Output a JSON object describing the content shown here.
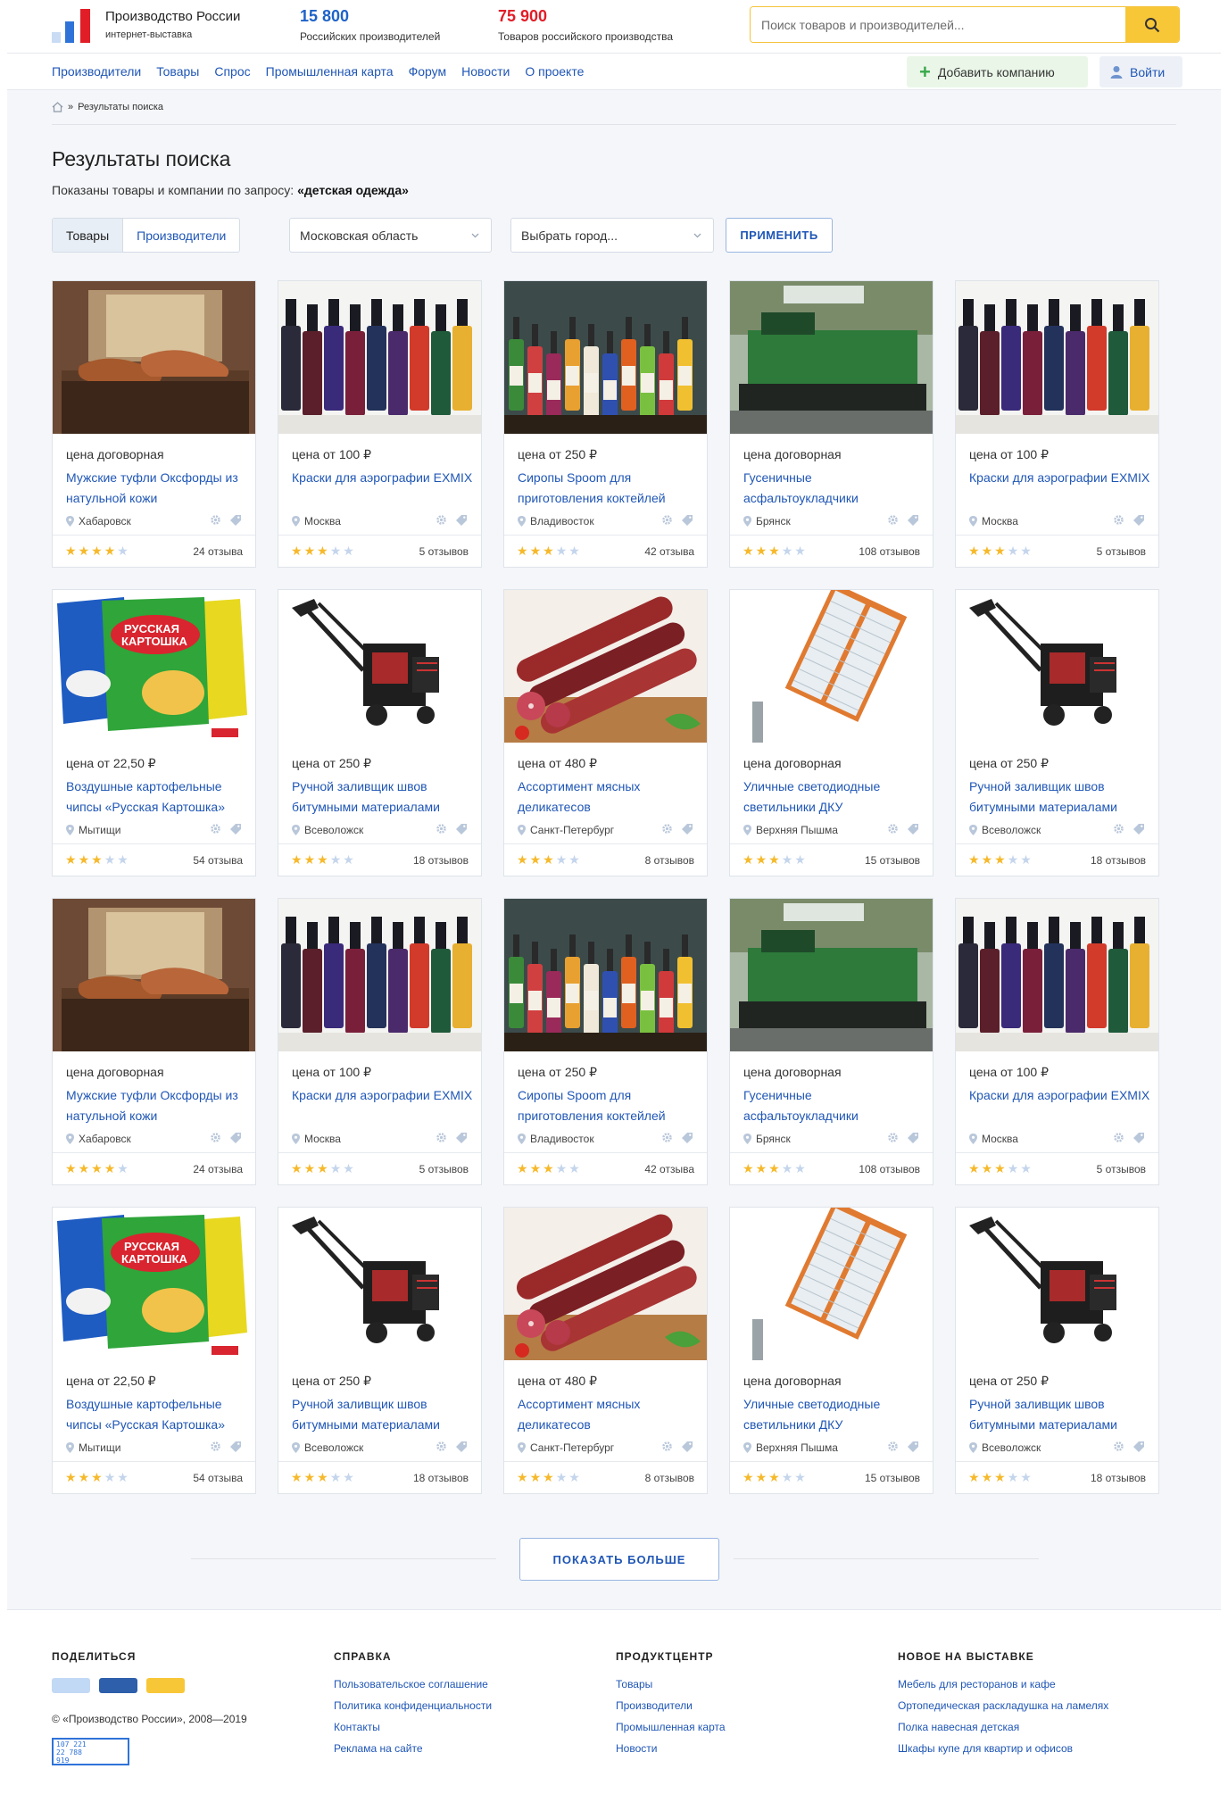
{
  "header": {
    "brand_title": "Производство России",
    "brand_sub": "интернет-выставка",
    "stat1_num": "15 800",
    "stat1_label": "Российских производителей",
    "stat2_num": "75 900",
    "stat2_label": "Товаров российского производства",
    "search_placeholder": "Поиск товаров и производителей..."
  },
  "nav": {
    "links": [
      "Производители",
      "Товары",
      "Спрос",
      "Промышленная карта",
      "Форум",
      "Новости",
      "О проекте"
    ],
    "add_company": "Добавить компанию",
    "login": "Войти"
  },
  "breadcrumb": {
    "sep": "»",
    "current": "Результаты поиска"
  },
  "page": {
    "title": "Результаты поиска",
    "query_prefix": "Показаны товары и компании по запросу:",
    "query": "«детская одежда»"
  },
  "filters": {
    "tab_goods": "Товары",
    "tab_makers": "Производители",
    "region": "Московская область",
    "city_placeholder": "Выбрать город...",
    "apply": "ПРИМЕНИТЬ"
  },
  "products": [
    {
      "price": "цена договорная",
      "title": "Мужские туфли Оксфорды из натульной кожи",
      "city": "Хабаровск",
      "stars": 4,
      "reviews": "24 отзыва",
      "img": "shoes"
    },
    {
      "price": "цена от 100 ₽",
      "title": "Краски для аэрографии EXMIX",
      "city": "Москва",
      "stars": 3,
      "reviews": "5 отзывов",
      "img": "paints"
    },
    {
      "price": "цена от 250 ₽",
      "title": "Сиропы Spoom для приготовления коктейлей",
      "city": "Владивосток",
      "stars": 3,
      "reviews": "42 отзыва",
      "img": "syrups"
    },
    {
      "price": "цена договорная",
      "title": "Гусеничные асфальтоукладчики",
      "city": "Брянск",
      "stars": 3,
      "reviews": "108 отзывов",
      "img": "paver"
    },
    {
      "price": "цена от 100 ₽",
      "title": "Краски для аэрографии EXMIX",
      "city": "Москва",
      "stars": 3,
      "reviews": "5 отзывов",
      "img": "paints"
    },
    {
      "price": "цена от 22,50 ₽",
      "title": "Воздушные картофельные чипсы «Русская Картошка»",
      "city": "Мытищи",
      "stars": 3,
      "reviews": "54 отзыва",
      "img": "chips"
    },
    {
      "price": "цена от 250 ₽",
      "title": "Ручной заливщик швов битумными материалами",
      "city": "Всеволожск",
      "stars": 3,
      "reviews": "18 отзывов",
      "img": "sealer"
    },
    {
      "price": "цена от 480 ₽",
      "title": "Ассортимент мясных деликатесов",
      "city": "Санкт-Петербург",
      "stars": 3,
      "reviews": "8 отзывов",
      "img": "sausage"
    },
    {
      "price": "цена договорная",
      "title": "Уличные светодиодные светильники ДКУ",
      "city": "Верхняя Пышма",
      "stars": 3,
      "reviews": "15 отзывов",
      "img": "lamp"
    },
    {
      "price": "цена от 250 ₽",
      "title": "Ручной заливщик швов битумными материалами",
      "city": "Всеволожск",
      "stars": 3,
      "reviews": "18 отзывов",
      "img": "sealer"
    },
    {
      "price": "цена договорная",
      "title": "Мужские туфли Оксфорды из натульной кожи",
      "city": "Хабаровск",
      "stars": 4,
      "reviews": "24 отзыва",
      "img": "shoes"
    },
    {
      "price": "цена от 100 ₽",
      "title": "Краски для аэрографии EXMIX",
      "city": "Москва",
      "stars": 3,
      "reviews": "5 отзывов",
      "img": "paints"
    },
    {
      "price": "цена от 250 ₽",
      "title": "Сиропы Spoom для приготовления коктейлей",
      "city": "Владивосток",
      "stars": 3,
      "reviews": "42 отзыва",
      "img": "syrups"
    },
    {
      "price": "цена договорная",
      "title": "Гусеничные асфальтоукладчики",
      "city": "Брянск",
      "stars": 3,
      "reviews": "108 отзывов",
      "img": "paver"
    },
    {
      "price": "цена от 100 ₽",
      "title": "Краски для аэрографии EXMIX",
      "city": "Москва",
      "stars": 3,
      "reviews": "5 отзывов",
      "img": "paints"
    },
    {
      "price": "цена от 22,50 ₽",
      "title": "Воздушные картофельные чипсы «Русская Картошка»",
      "city": "Мытищи",
      "stars": 3,
      "reviews": "54 отзыва",
      "img": "chips"
    },
    {
      "price": "цена от 250 ₽",
      "title": "Ручной заливщик швов битумными материалами",
      "city": "Всеволожск",
      "stars": 3,
      "reviews": "18 отзывов",
      "img": "sealer"
    },
    {
      "price": "цена от 480 ₽",
      "title": "Ассортимент мясных деликатесов",
      "city": "Санкт-Петербург",
      "stars": 3,
      "reviews": "8 отзывов",
      "img": "sausage"
    },
    {
      "price": "цена договорная",
      "title": "Уличные светодиодные светильники ДКУ",
      "city": "Верхняя Пышма",
      "stars": 3,
      "reviews": "15 отзывов",
      "img": "lamp"
    },
    {
      "price": "цена от 250 ₽",
      "title": "Ручной заливщик швов битумными материалами",
      "city": "Всеволожск",
      "stars": 3,
      "reviews": "18 отзывов",
      "img": "sealer"
    }
  ],
  "show_more": "ПОКАЗАТЬ БОЛЬШЕ",
  "footer": {
    "share_title": "ПОДЕЛИТЬСЯ",
    "share_colors": [
      "#c2d9f5",
      "#2d5faa",
      "#f8c738"
    ],
    "copyright": "© «Производство России», 2008—2019",
    "counter_lines": [
      "107 221",
      "22 788",
      "919"
    ],
    "help_title": "СПРАВКА",
    "help_links": [
      "Пользовательское соглашение",
      "Политика конфиденциальности",
      "Контакты",
      "Реклама на сайте"
    ],
    "product_title": "ПРОДУКТЦЕНТР",
    "product_links": [
      "Товары",
      "Производители",
      "Промышленная карта",
      "Новости"
    ],
    "new_title": "НОВОЕ НА ВЫСТАВКЕ",
    "new_links": [
      "Мебель для ресторанов и кафе",
      "Ортопедическая раскладушка на ламелях",
      "Полка навесная детская",
      "Шкафы купе для квартир и офисов"
    ]
  },
  "colors": {
    "accent": "#1f56b6",
    "search_button": "#f8c738",
    "brand_red": "#e11d28",
    "star": "#f6b92b"
  }
}
